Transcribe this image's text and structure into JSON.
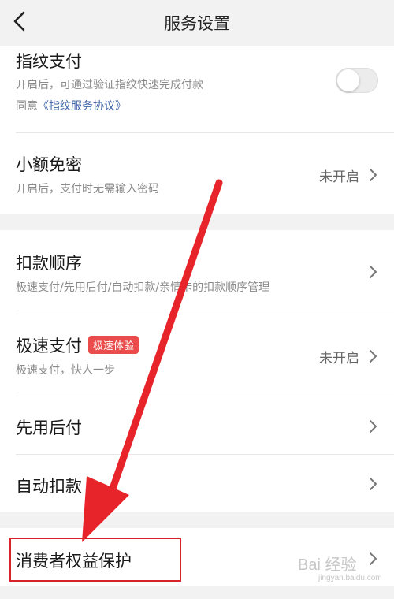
{
  "header": {
    "title": "服务设置",
    "back_icon": "chevron-left-icon"
  },
  "settings": {
    "fingerprint": {
      "title": "指纹支付",
      "desc": "开启后，可通过验证指纹快速完成付款",
      "agree_prefix": "同意",
      "agree_link": "《指纹服务协议》",
      "enabled": false
    },
    "small_amount": {
      "title": "小额免密",
      "desc": "开启后，支付时无需输入密码",
      "status": "未开启"
    },
    "deduct_order": {
      "title": "扣款顺序",
      "desc": "极速支付/先用后付/自动扣款/亲情卡的扣款顺序管理"
    },
    "express_pay": {
      "title": "极速支付",
      "badge": "极速体验",
      "desc": "极速支付，快人一步",
      "status": "未开启"
    },
    "pay_later": {
      "title": "先用后付"
    },
    "auto_deduct": {
      "title": "自动扣款"
    },
    "consumer_protection": {
      "title": "消费者权益保护"
    }
  },
  "watermark": {
    "text": "Bai 经验",
    "sub": "jingyan.baidu.com"
  },
  "colors": {
    "link": "#3f64a8",
    "badge": "#ea4b4b",
    "annotation": "#d9232a"
  }
}
